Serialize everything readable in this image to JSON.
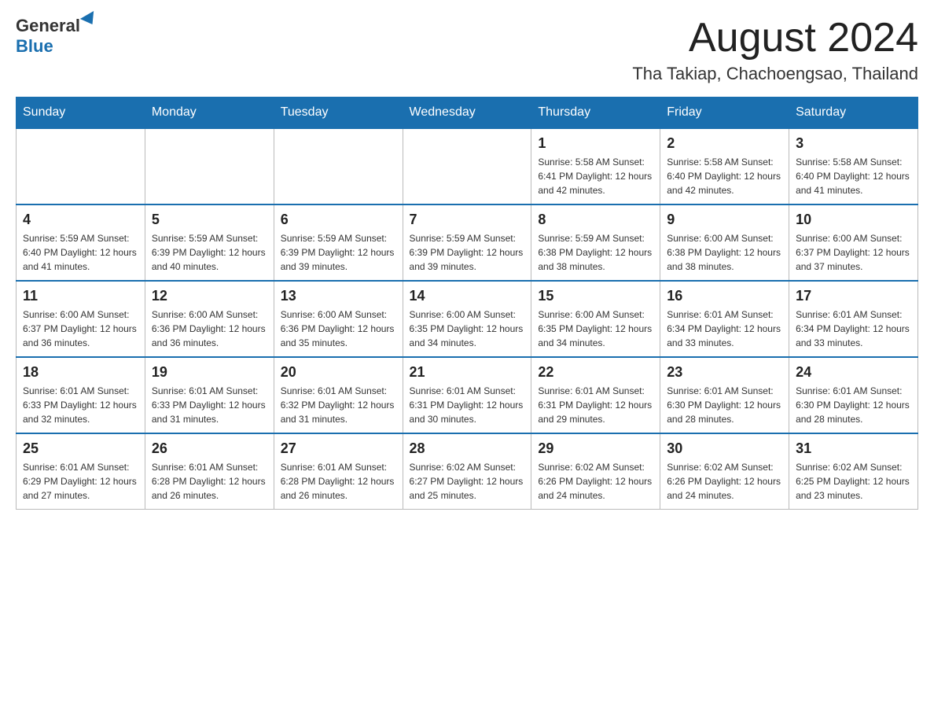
{
  "header": {
    "logo_general": "General",
    "logo_blue": "Blue",
    "main_title": "August 2024",
    "subtitle": "Tha Takiap, Chachoengsao, Thailand"
  },
  "days_of_week": [
    "Sunday",
    "Monday",
    "Tuesday",
    "Wednesday",
    "Thursday",
    "Friday",
    "Saturday"
  ],
  "weeks": [
    {
      "days": [
        {
          "number": "",
          "info": ""
        },
        {
          "number": "",
          "info": ""
        },
        {
          "number": "",
          "info": ""
        },
        {
          "number": "",
          "info": ""
        },
        {
          "number": "1",
          "info": "Sunrise: 5:58 AM\nSunset: 6:41 PM\nDaylight: 12 hours and 42 minutes."
        },
        {
          "number": "2",
          "info": "Sunrise: 5:58 AM\nSunset: 6:40 PM\nDaylight: 12 hours and 42 minutes."
        },
        {
          "number": "3",
          "info": "Sunrise: 5:58 AM\nSunset: 6:40 PM\nDaylight: 12 hours and 41 minutes."
        }
      ]
    },
    {
      "days": [
        {
          "number": "4",
          "info": "Sunrise: 5:59 AM\nSunset: 6:40 PM\nDaylight: 12 hours and 41 minutes."
        },
        {
          "number": "5",
          "info": "Sunrise: 5:59 AM\nSunset: 6:39 PM\nDaylight: 12 hours and 40 minutes."
        },
        {
          "number": "6",
          "info": "Sunrise: 5:59 AM\nSunset: 6:39 PM\nDaylight: 12 hours and 39 minutes."
        },
        {
          "number": "7",
          "info": "Sunrise: 5:59 AM\nSunset: 6:39 PM\nDaylight: 12 hours and 39 minutes."
        },
        {
          "number": "8",
          "info": "Sunrise: 5:59 AM\nSunset: 6:38 PM\nDaylight: 12 hours and 38 minutes."
        },
        {
          "number": "9",
          "info": "Sunrise: 6:00 AM\nSunset: 6:38 PM\nDaylight: 12 hours and 38 minutes."
        },
        {
          "number": "10",
          "info": "Sunrise: 6:00 AM\nSunset: 6:37 PM\nDaylight: 12 hours and 37 minutes."
        }
      ]
    },
    {
      "days": [
        {
          "number": "11",
          "info": "Sunrise: 6:00 AM\nSunset: 6:37 PM\nDaylight: 12 hours and 36 minutes."
        },
        {
          "number": "12",
          "info": "Sunrise: 6:00 AM\nSunset: 6:36 PM\nDaylight: 12 hours and 36 minutes."
        },
        {
          "number": "13",
          "info": "Sunrise: 6:00 AM\nSunset: 6:36 PM\nDaylight: 12 hours and 35 minutes."
        },
        {
          "number": "14",
          "info": "Sunrise: 6:00 AM\nSunset: 6:35 PM\nDaylight: 12 hours and 34 minutes."
        },
        {
          "number": "15",
          "info": "Sunrise: 6:00 AM\nSunset: 6:35 PM\nDaylight: 12 hours and 34 minutes."
        },
        {
          "number": "16",
          "info": "Sunrise: 6:01 AM\nSunset: 6:34 PM\nDaylight: 12 hours and 33 minutes."
        },
        {
          "number": "17",
          "info": "Sunrise: 6:01 AM\nSunset: 6:34 PM\nDaylight: 12 hours and 33 minutes."
        }
      ]
    },
    {
      "days": [
        {
          "number": "18",
          "info": "Sunrise: 6:01 AM\nSunset: 6:33 PM\nDaylight: 12 hours and 32 minutes."
        },
        {
          "number": "19",
          "info": "Sunrise: 6:01 AM\nSunset: 6:33 PM\nDaylight: 12 hours and 31 minutes."
        },
        {
          "number": "20",
          "info": "Sunrise: 6:01 AM\nSunset: 6:32 PM\nDaylight: 12 hours and 31 minutes."
        },
        {
          "number": "21",
          "info": "Sunrise: 6:01 AM\nSunset: 6:31 PM\nDaylight: 12 hours and 30 minutes."
        },
        {
          "number": "22",
          "info": "Sunrise: 6:01 AM\nSunset: 6:31 PM\nDaylight: 12 hours and 29 minutes."
        },
        {
          "number": "23",
          "info": "Sunrise: 6:01 AM\nSunset: 6:30 PM\nDaylight: 12 hours and 28 minutes."
        },
        {
          "number": "24",
          "info": "Sunrise: 6:01 AM\nSunset: 6:30 PM\nDaylight: 12 hours and 28 minutes."
        }
      ]
    },
    {
      "days": [
        {
          "number": "25",
          "info": "Sunrise: 6:01 AM\nSunset: 6:29 PM\nDaylight: 12 hours and 27 minutes."
        },
        {
          "number": "26",
          "info": "Sunrise: 6:01 AM\nSunset: 6:28 PM\nDaylight: 12 hours and 26 minutes."
        },
        {
          "number": "27",
          "info": "Sunrise: 6:01 AM\nSunset: 6:28 PM\nDaylight: 12 hours and 26 minutes."
        },
        {
          "number": "28",
          "info": "Sunrise: 6:02 AM\nSunset: 6:27 PM\nDaylight: 12 hours and 25 minutes."
        },
        {
          "number": "29",
          "info": "Sunrise: 6:02 AM\nSunset: 6:26 PM\nDaylight: 12 hours and 24 minutes."
        },
        {
          "number": "30",
          "info": "Sunrise: 6:02 AM\nSunset: 6:26 PM\nDaylight: 12 hours and 24 minutes."
        },
        {
          "number": "31",
          "info": "Sunrise: 6:02 AM\nSunset: 6:25 PM\nDaylight: 12 hours and 23 minutes."
        }
      ]
    }
  ]
}
